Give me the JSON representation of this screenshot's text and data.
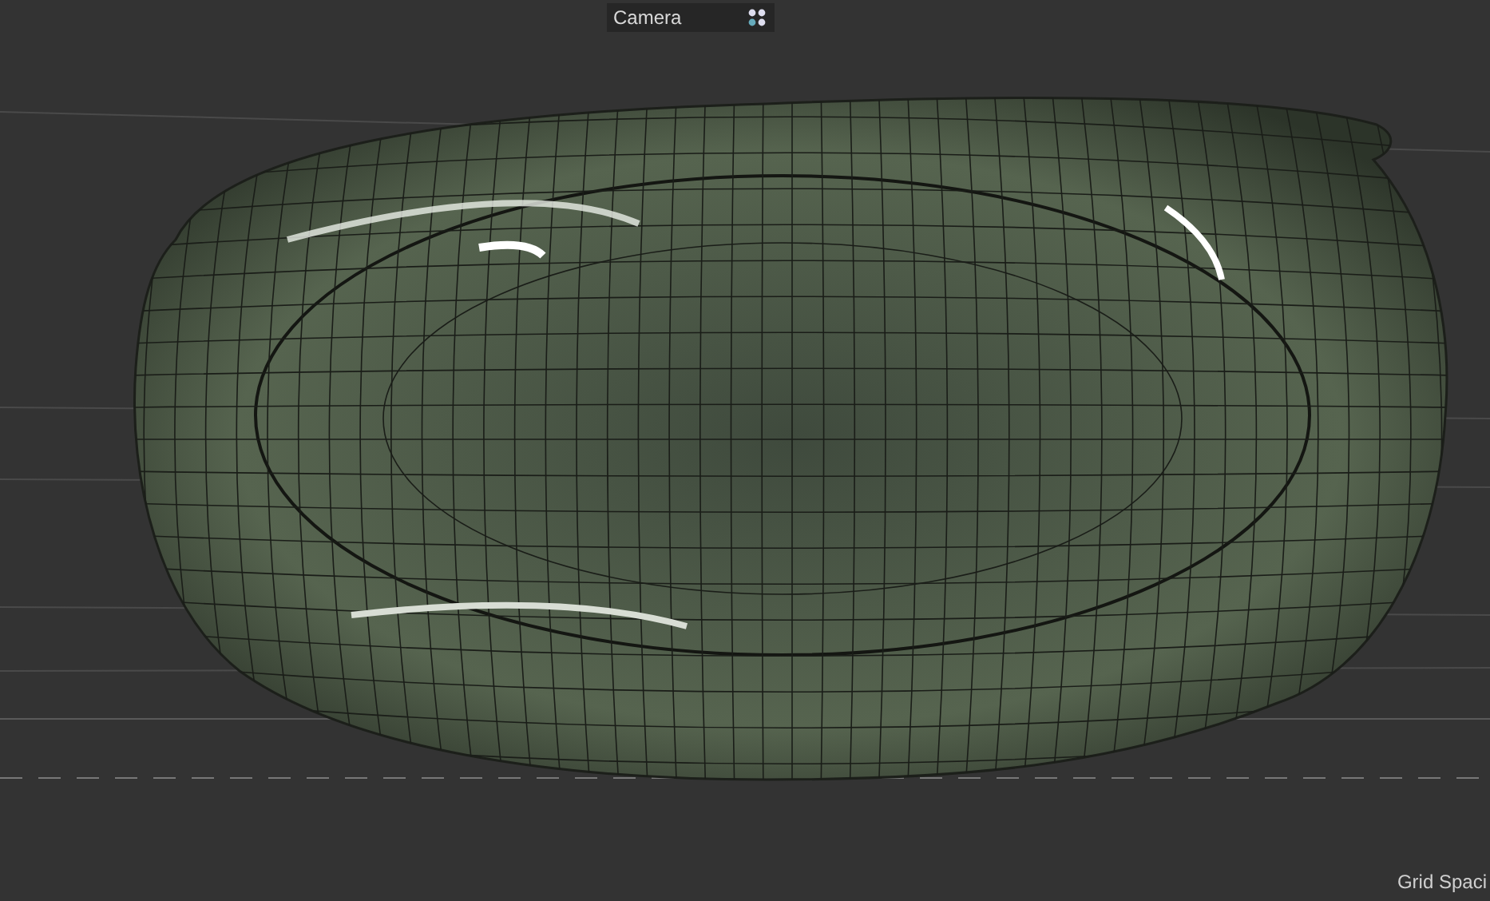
{
  "viewport": {
    "camera_menu": {
      "label": "Camera"
    },
    "grid_spacing_label": "Grid Spaci"
  }
}
